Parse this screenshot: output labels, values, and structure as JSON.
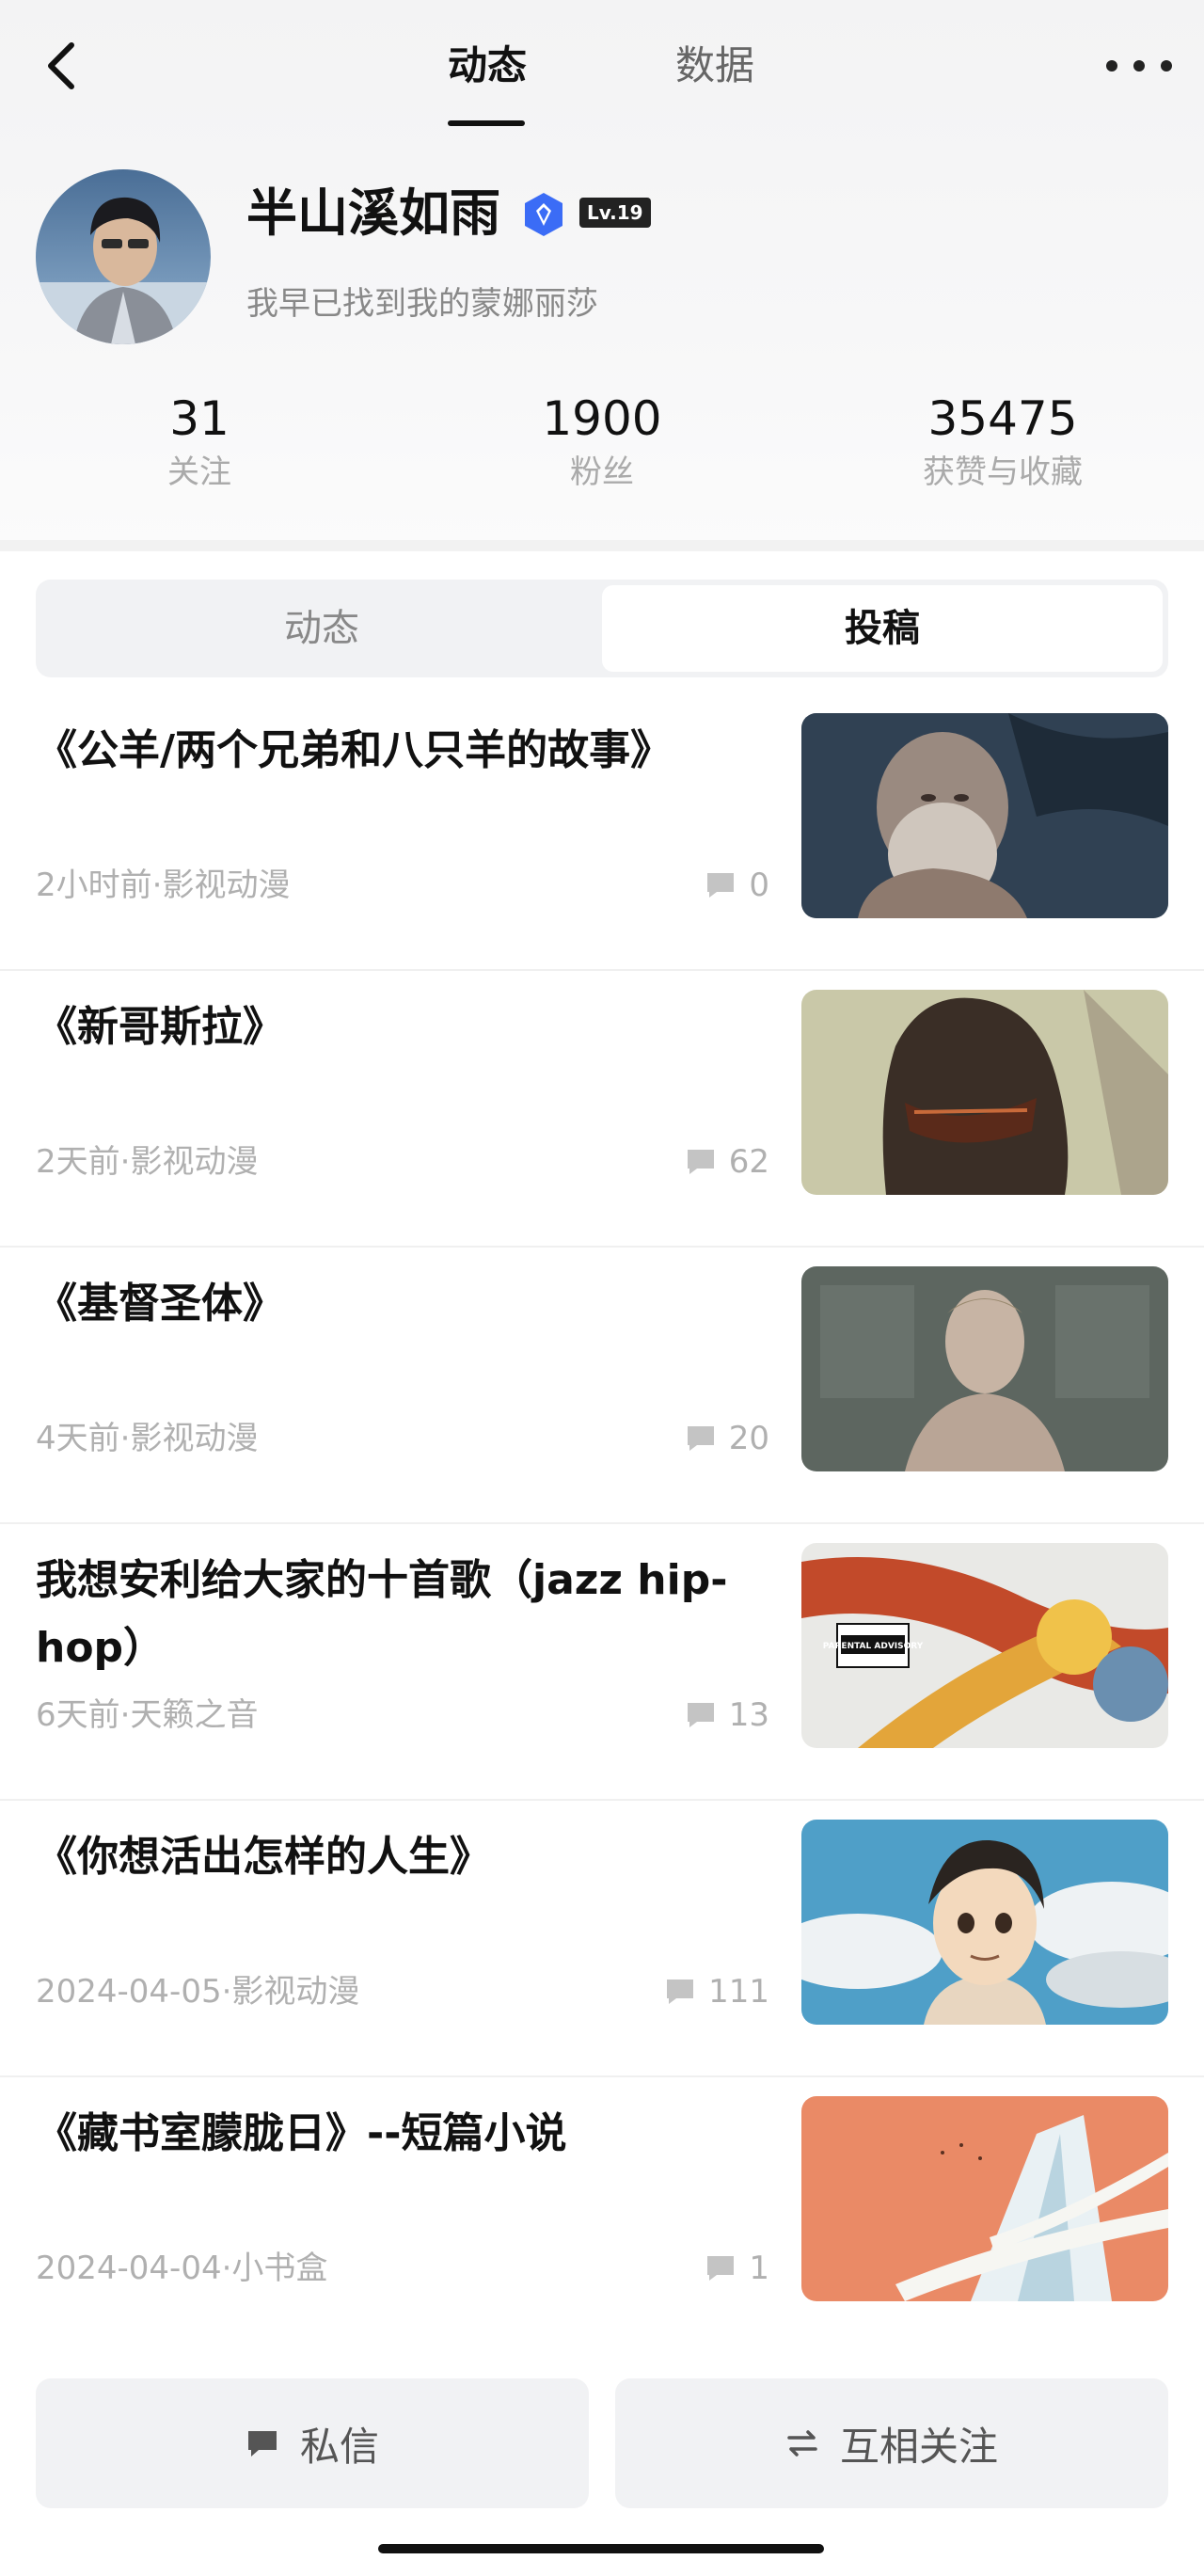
{
  "nav": {
    "tabs": [
      {
        "label": "动态",
        "active": true
      },
      {
        "label": "数据",
        "active": false
      }
    ]
  },
  "profile": {
    "username": "半山溪如雨",
    "level": "Lv.19",
    "signature": "我早已找到我的蒙娜丽莎",
    "stats": [
      {
        "value": "31",
        "label": "关注"
      },
      {
        "value": "1900",
        "label": "粉丝"
      },
      {
        "value": "35475",
        "label": "获赞与收藏"
      }
    ]
  },
  "segment": {
    "items": [
      {
        "label": "动态",
        "active": false
      },
      {
        "label": "投稿",
        "active": true
      }
    ]
  },
  "posts": [
    {
      "title": "《公羊/两个兄弟和八只羊的故事》",
      "meta": "2小时前·影视动漫",
      "comments": "0"
    },
    {
      "title": "《新哥斯拉》",
      "meta": "2天前·影视动漫",
      "comments": "62"
    },
    {
      "title": "《基督圣体》",
      "meta": "4天前·影视动漫",
      "comments": "20"
    },
    {
      "title": "我想安利给大家的十首歌（jazz hip-hop）",
      "meta": "6天前·天籁之音",
      "comments": "13"
    },
    {
      "title": "《你想活出怎样的人生》",
      "meta": "2024-04-05·影视动漫",
      "comments": "111"
    },
    {
      "title": "《藏书室朦胧日》--短篇小说",
      "meta": "2024-04-04·小书盒",
      "comments": "1"
    }
  ],
  "album_cover_text": "PARENTAL ADVISORY EXPLICIT CONTENT",
  "bottom": {
    "message_label": "私信",
    "follow_label": "互相关注"
  },
  "colors": {
    "verified_badge": "#3b6cf6",
    "text_primary": "#111111",
    "text_secondary": "#b0b0b0",
    "button_bg": "#f1f2f4"
  }
}
